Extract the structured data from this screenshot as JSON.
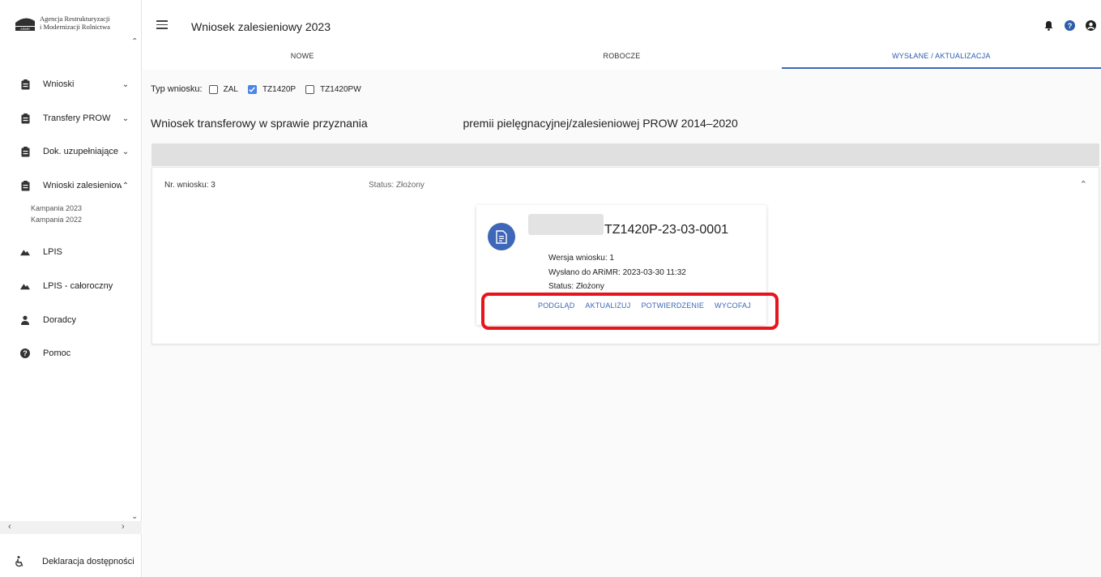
{
  "logo": {
    "line1": "Agencja Restrukturyzacji",
    "line2": "i Modernizacji Rolnictwa",
    "mark_text": "ARiMR"
  },
  "sidebar": {
    "items": [
      {
        "label": "Wnioski",
        "icon": "clipboard-icon",
        "chevron": "down"
      },
      {
        "label": "Transfery PROW",
        "icon": "clipboard-icon",
        "chevron": "down"
      },
      {
        "label": "Dok. uzupełniające",
        "icon": "clipboard-icon",
        "chevron": "down"
      },
      {
        "label": "Wnioski zalesieniowe",
        "icon": "clipboard-icon",
        "chevron": "up"
      },
      {
        "label": "LPIS",
        "icon": "mountains-icon"
      },
      {
        "label": "LPIS - całoroczny",
        "icon": "mountains-icon"
      },
      {
        "label": "Doradcy",
        "icon": "person-icon"
      },
      {
        "label": "Pomoc",
        "icon": "help-icon"
      }
    ],
    "subitems": [
      "Kampania 2023",
      "Kampania 2022"
    ],
    "accessibility": "Deklaracja dostępności"
  },
  "header": {
    "title": "Wniosek zalesieniowy 2023",
    "icons": [
      "bell-icon",
      "help-icon",
      "account-icon"
    ]
  },
  "tabs": [
    {
      "label": "NOWE",
      "active": false
    },
    {
      "label": "ROBOCZE",
      "active": false
    },
    {
      "label": "WYSŁANE / AKTUALIZACJA",
      "active": true
    }
  ],
  "filter": {
    "label": "Typ wniosku:",
    "options": [
      {
        "label": "ZAL",
        "checked": false
      },
      {
        "label": "TZ1420P",
        "checked": true
      },
      {
        "label": "TZ1420PW",
        "checked": false
      }
    ]
  },
  "document": {
    "title_part1": "Wniosek transferowy w sprawie przyznania",
    "title_part2": "premii pielęgnacyjnej/zalesieniowej PROW 2014–2020"
  },
  "panel": {
    "number": "Nr. wniosku: 3",
    "status": "Status: Złożony"
  },
  "card": {
    "id": "TZ1420P-23-03-0001",
    "version": "Wersja wniosku: 1",
    "sent": "Wysłano do ARiMR: 2023-03-30 11:32",
    "status": "Status: Złożony",
    "actions": [
      "PODGLĄD",
      "AKTUALIZUJ",
      "POTWIERDZENIE",
      "WYCOFAJ"
    ]
  },
  "colors": {
    "accent": "#3a6ab8",
    "avatar": "#3f67b8",
    "highlight": "#e8141b",
    "checkbox": "#4a86e8"
  }
}
